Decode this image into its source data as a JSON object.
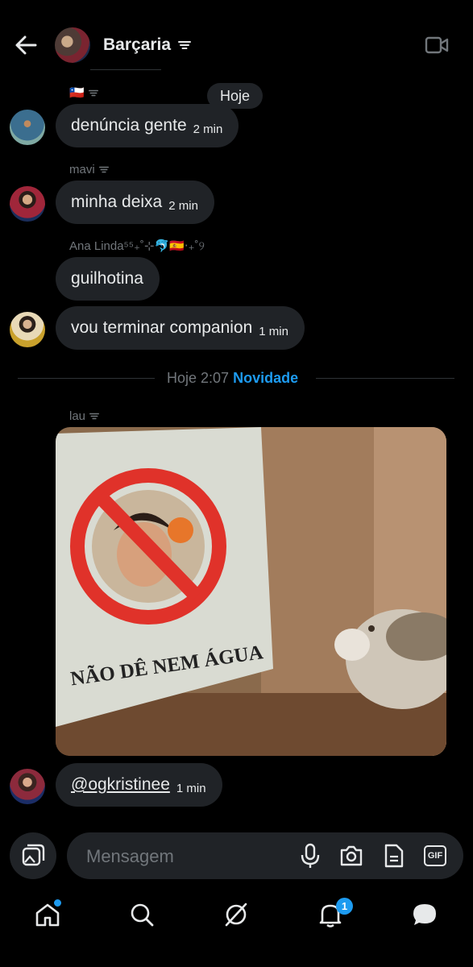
{
  "header": {
    "title": "Barçaria",
    "back_icon": "arrow-left-icon",
    "video_icon": "video-icon"
  },
  "day_pill": "Hoje",
  "messages": [
    {
      "sender": "🇨🇱",
      "text": "denúncia gente",
      "time": "2 min"
    },
    {
      "sender": "mavi",
      "text": "minha deixa",
      "time": "2 min"
    },
    {
      "sender": "Ana Linda⁵⁵₊˚⊹🐬🇪🇸‧₊˚୨",
      "text": "guilhotina",
      "time": ""
    },
    {
      "sender": "",
      "text": "vou terminar companion",
      "time": "1 min"
    }
  ],
  "divider": {
    "time": "Hoje 2:07",
    "label": "Novidade"
  },
  "image_message": {
    "sender": "lau",
    "caption": "NÃO DÊ NEM ÁGUA"
  },
  "last_message": {
    "text": "@ogkristinee",
    "time": "1 min"
  },
  "composer": {
    "placeholder": "Mensagem",
    "gif_label": "GIF"
  },
  "nav": {
    "notifications_badge": "1"
  },
  "colors": {
    "accent": "#1d9bf0",
    "bubble": "#202327",
    "muted": "#71767b",
    "background": "#000000"
  }
}
